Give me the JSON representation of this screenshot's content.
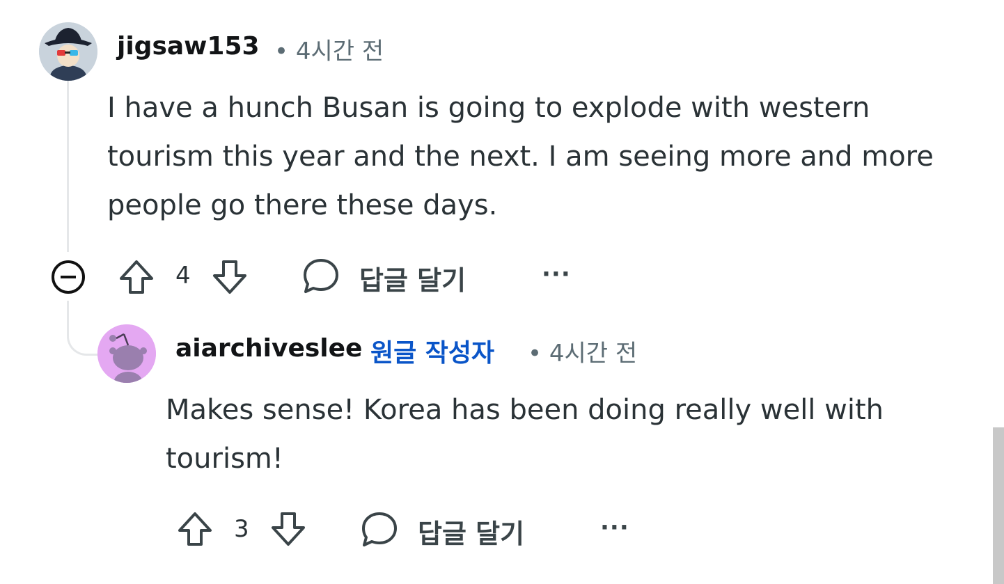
{
  "comment": {
    "username": "jigsaw153",
    "time": "• 4시간 전",
    "text": "I have a hunch Busan is going to explode with western tourism this year and the next. I am seeing more and more people go there these days.",
    "votes": "4",
    "reply_label": "답글 달기",
    "more_label": "···",
    "avatar_icon": "cartoon-hat-avatar-icon"
  },
  "reply": {
    "username": "aiarchiveslee",
    "op_badge": "원글 작성자",
    "time": "• 4시간 전",
    "text": "Makes sense! Korea has been doing really well with tourism!",
    "votes": "3",
    "reply_label": "답글 달기",
    "more_label": "···",
    "avatar_icon": "snoo-avatar-icon"
  },
  "colors": {
    "text": "#2a3236",
    "meta": "#5c6c74",
    "op_badge": "#0a55c8",
    "thread_line": "#e5e7e9",
    "reply_avatar_bg": "#e4a8f2"
  }
}
